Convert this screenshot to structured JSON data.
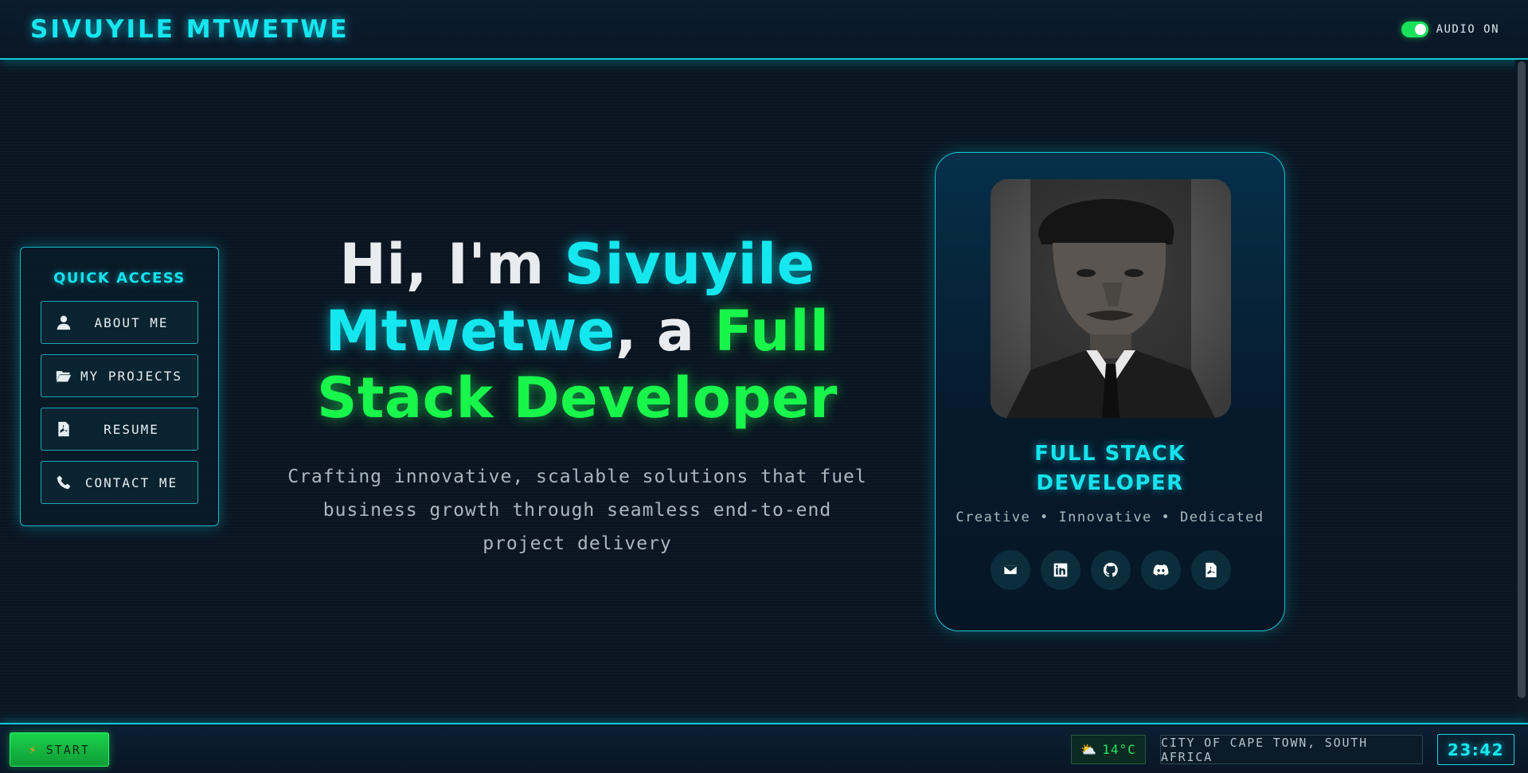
{
  "header": {
    "brand": "SIVUYILE MTWETWE",
    "audio_label": "AUDIO ON",
    "audio_on": true
  },
  "quick_access": {
    "title": "QUICK ACCESS",
    "items": [
      {
        "label": "ABOUT ME",
        "icon": "user-icon"
      },
      {
        "label": "MY PROJECTS",
        "icon": "folder-open-icon"
      },
      {
        "label": "RESUME",
        "icon": "pdf-file-icon"
      },
      {
        "label": "CONTACT ME",
        "icon": "phone-icon"
      }
    ]
  },
  "hero": {
    "greeting": "Hi, I'm ",
    "name": "Sivuyile Mtwetwe",
    "connector": ", a ",
    "role": "Full Stack Developer",
    "subtitle": "Crafting innovative, scalable solutions that fuel business growth through seamless end-to-end project delivery"
  },
  "profile": {
    "role_line1": "FULL STACK",
    "role_line2": "DEVELOPER",
    "tags": "Creative • Innovative • Dedicated",
    "socials": [
      "email-icon",
      "linkedin-icon",
      "github-icon",
      "discord-icon",
      "pdf-file-icon"
    ]
  },
  "taskbar": {
    "start_label": "START",
    "weather_icon": "partly-cloudy-icon",
    "temperature": "14°C",
    "location": "CITY OF CAPE TOWN, SOUTH AFRICA",
    "time": "23:42"
  },
  "colors": {
    "accent_cyan": "#15e7ee",
    "accent_green": "#18f54b",
    "background": "#0a1522"
  }
}
